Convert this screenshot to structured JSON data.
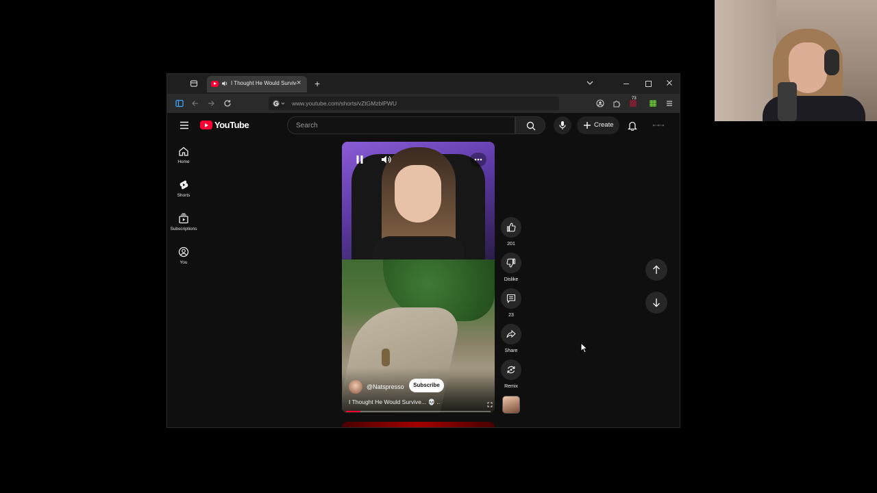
{
  "browser": {
    "tab_title": "I Thought He Would Survive",
    "tab_close": "×",
    "new_tab": "+",
    "url": "www.youtube.com/shorts/vZtGMzblPWU",
    "extension_badge": "73"
  },
  "youtube": {
    "logo_text": "YouTube",
    "search_placeholder": "Search",
    "create_label": "Create",
    "sidebar": [
      {
        "label": "Home",
        "icon": "home-icon"
      },
      {
        "label": "Shorts",
        "icon": "shorts-icon"
      },
      {
        "label": "Subscriptions",
        "icon": "subscriptions-icon"
      },
      {
        "label": "You",
        "icon": "you-icon"
      }
    ],
    "short": {
      "channel": "@Natspresso",
      "subscribe_label": "Subscribe",
      "title": "I Thought He Would Survive... 💀 ..",
      "progress_fraction": 0.1
    },
    "actions": {
      "like_count": "201",
      "dislike_label": "Dislike",
      "comment_count": "23",
      "share_label": "Share",
      "remix_label": "Remix"
    }
  },
  "colors": {
    "brand_red": "#ff0033",
    "background": "#0f0f0f",
    "chip": "#272727"
  }
}
